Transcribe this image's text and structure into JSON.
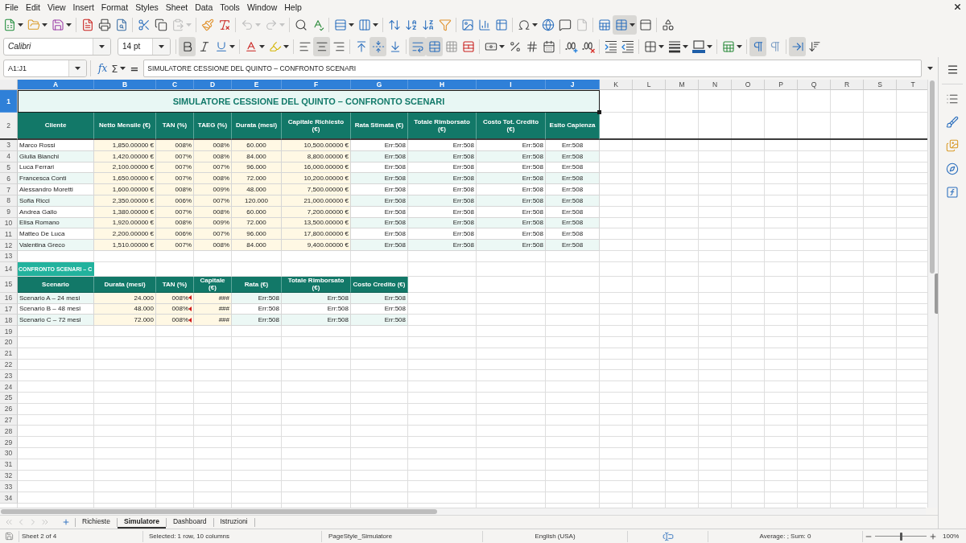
{
  "menu_bar": {
    "items": [
      "File",
      "Edit",
      "View",
      "Insert",
      "Format",
      "Styles",
      "Sheet",
      "Data",
      "Tools",
      "Window",
      "Help"
    ]
  },
  "standard_toolbar": {
    "groups": [
      [
        {
          "kind": "new",
          "dropdown": true,
          "pressed": false,
          "disabled": false
        },
        {
          "kind": "open",
          "dropdown": true,
          "pressed": false,
          "disabled": false
        },
        {
          "kind": "save",
          "dropdown": true,
          "pressed": false,
          "disabled": false
        }
      ],
      [
        {
          "kind": "export_pdf",
          "dropdown": false,
          "pressed": false,
          "disabled": false
        },
        {
          "kind": "print",
          "dropdown": false,
          "pressed": false,
          "disabled": false
        },
        {
          "kind": "print_preview",
          "dropdown": false,
          "pressed": false,
          "disabled": false
        }
      ],
      [
        {
          "kind": "cut",
          "dropdown": false,
          "pressed": false,
          "disabled": false
        },
        {
          "kind": "copy",
          "dropdown": false,
          "pressed": false,
          "disabled": false
        },
        {
          "kind": "paste",
          "dropdown": true,
          "pressed": false,
          "disabled": true
        }
      ],
      [
        {
          "kind": "clone_formatting",
          "dropdown": false,
          "pressed": false,
          "disabled": false
        },
        {
          "kind": "clear_formatting",
          "dropdown": false,
          "pressed": false,
          "disabled": false
        }
      ],
      [
        {
          "kind": "undo",
          "dropdown": true,
          "pressed": false,
          "disabled": true
        },
        {
          "kind": "redo",
          "dropdown": true,
          "pressed": false,
          "disabled": true
        }
      ],
      [
        {
          "kind": "find_replace",
          "dropdown": false,
          "pressed": false,
          "disabled": false
        },
        {
          "kind": "spelling",
          "dropdown": false,
          "pressed": false,
          "disabled": false
        }
      ],
      [
        {
          "kind": "rows",
          "dropdown": true,
          "pressed": false,
          "disabled": false
        },
        {
          "kind": "columns",
          "dropdown": true,
          "pressed": false,
          "disabled": false
        }
      ],
      [
        {
          "kind": "sort",
          "dropdown": false,
          "pressed": false,
          "disabled": false
        },
        {
          "kind": "sort_ascending",
          "dropdown": false,
          "pressed": false,
          "disabled": false
        },
        {
          "kind": "sort_descending",
          "dropdown": false,
          "pressed": false,
          "disabled": false
        },
        {
          "kind": "autofilter",
          "dropdown": false,
          "pressed": false,
          "disabled": false
        }
      ],
      [
        {
          "kind": "image",
          "dropdown": false,
          "pressed": false,
          "disabled": false
        },
        {
          "kind": "chart",
          "dropdown": false,
          "pressed": false,
          "disabled": false
        },
        {
          "kind": "pivot_table",
          "dropdown": false,
          "pressed": false,
          "disabled": false
        }
      ],
      [
        {
          "kind": "special_character",
          "dropdown": true,
          "pressed": false,
          "disabled": false
        },
        {
          "kind": "hyperlink",
          "dropdown": false,
          "pressed": false,
          "disabled": false
        },
        {
          "kind": "comment",
          "dropdown": false,
          "pressed": false,
          "disabled": false
        },
        {
          "kind": "header_footer",
          "dropdown": false,
          "pressed": false,
          "disabled": true
        }
      ],
      [
        {
          "kind": "print_area",
          "dropdown": false,
          "pressed": false,
          "disabled": false
        },
        {
          "kind": "freeze",
          "dropdown": true,
          "pressed": true,
          "disabled": false
        },
        {
          "kind": "split_window",
          "dropdown": false,
          "pressed": false,
          "disabled": false
        }
      ],
      [
        {
          "kind": "shapes",
          "dropdown": false,
          "pressed": false,
          "disabled": false
        }
      ]
    ]
  },
  "formatting_toolbar": {
    "font_name": "Calibri",
    "font_size": "14 pt",
    "groups": [
      [
        {
          "kind": "bold",
          "dropdown": false,
          "pressed": true,
          "disabled": false
        },
        {
          "kind": "italic",
          "dropdown": false,
          "pressed": false,
          "disabled": false
        },
        {
          "kind": "underline",
          "dropdown": true,
          "pressed": false,
          "disabled": false
        }
      ],
      [
        {
          "kind": "font_color",
          "dropdown": true,
          "pressed": false,
          "disabled": false
        },
        {
          "kind": "highlight",
          "dropdown": true,
          "pressed": false,
          "disabled": false
        }
      ],
      [
        {
          "kind": "align_left",
          "dropdown": false,
          "pressed": false,
          "disabled": false
        },
        {
          "kind": "align_center",
          "dropdown": false,
          "pressed": true,
          "disabled": false
        },
        {
          "kind": "align_right",
          "dropdown": false,
          "pressed": false,
          "disabled": false
        }
      ],
      [
        {
          "kind": "align_top",
          "dropdown": false,
          "pressed": false,
          "disabled": false
        },
        {
          "kind": "align_middle",
          "dropdown": false,
          "pressed": true,
          "disabled": false
        },
        {
          "kind": "align_bottom",
          "dropdown": false,
          "pressed": false,
          "disabled": false
        }
      ],
      [
        {
          "kind": "wrap_text",
          "dropdown": false,
          "pressed": true,
          "disabled": false
        },
        {
          "kind": "merge_center",
          "dropdown": false,
          "pressed": true,
          "disabled": false
        },
        {
          "kind": "merge_cells",
          "dropdown": false,
          "pressed": false,
          "disabled": false
        },
        {
          "kind": "unmerge_cells",
          "dropdown": false,
          "pressed": false,
          "disabled": false
        }
      ],
      [
        {
          "kind": "currency",
          "dropdown": true,
          "pressed": false,
          "disabled": false
        },
        {
          "kind": "percent",
          "dropdown": false,
          "pressed": false,
          "disabled": false
        },
        {
          "kind": "number",
          "dropdown": false,
          "pressed": false,
          "disabled": false
        },
        {
          "kind": "date",
          "dropdown": false,
          "pressed": false,
          "disabled": false
        }
      ],
      [
        {
          "kind": "add_decimal",
          "dropdown": false,
          "pressed": false,
          "disabled": false
        },
        {
          "kind": "delete_decimal",
          "dropdown": false,
          "pressed": false,
          "disabled": false
        }
      ],
      [
        {
          "kind": "indent_increase",
          "dropdown": false,
          "pressed": false,
          "disabled": false
        },
        {
          "kind": "indent_decrease",
          "dropdown": false,
          "pressed": false,
          "disabled": false
        }
      ],
      [
        {
          "kind": "borders",
          "dropdown": true,
          "pressed": false,
          "disabled": false
        },
        {
          "kind": "border_style",
          "dropdown": true,
          "pressed": false,
          "disabled": false
        },
        {
          "kind": "border_color",
          "dropdown": true,
          "pressed": false,
          "disabled": false
        }
      ],
      [
        {
          "kind": "conditional_format",
          "dropdown": true,
          "pressed": false,
          "disabled": false
        }
      ],
      [
        {
          "kind": "left_to_right",
          "dropdown": false,
          "pressed": true,
          "disabled": false
        },
        {
          "kind": "right_to_left",
          "dropdown": false,
          "pressed": false,
          "disabled": false
        }
      ],
      [
        {
          "kind": "text_horizontal",
          "dropdown": false,
          "pressed": true,
          "disabled": false
        },
        {
          "kind": "text_vertical",
          "dropdown": false,
          "pressed": false,
          "disabled": false
        }
      ]
    ]
  },
  "formula_bar": {
    "name_box": "A1:J1",
    "function_wizard": "fx",
    "sum": "Σ",
    "formula": "=",
    "content": "SIMULATORE CESSIONE DEL QUINTO – CONFRONTO SCENARI"
  },
  "sheet": {
    "column_headers": [
      {
        "label": "A",
        "selected": true
      },
      {
        "label": "B",
        "selected": true
      },
      {
        "label": "C",
        "selected": true
      },
      {
        "label": "D",
        "selected": true
      },
      {
        "label": "E",
        "selected": true
      },
      {
        "label": "F",
        "selected": true
      },
      {
        "label": "G",
        "selected": true
      },
      {
        "label": "H",
        "selected": true
      },
      {
        "label": "I",
        "selected": true
      },
      {
        "label": "J",
        "selected": true
      },
      {
        "label": "K",
        "selected": false
      },
      {
        "label": "L",
        "selected": false
      },
      {
        "label": "M",
        "selected": false
      },
      {
        "label": "N",
        "selected": false
      },
      {
        "label": "O",
        "selected": false
      },
      {
        "label": "P",
        "selected": false
      },
      {
        "label": "Q",
        "selected": false
      },
      {
        "label": "R",
        "selected": false
      },
      {
        "label": "S",
        "selected": false
      },
      {
        "label": "T",
        "selected": false
      }
    ],
    "row_headers": [
      {
        "label": "1",
        "selected": true
      },
      {
        "label": "2",
        "selected": false
      },
      {
        "label": "3",
        "selected": false
      },
      {
        "label": "4",
        "selected": false
      },
      {
        "label": "5",
        "selected": false
      },
      {
        "label": "6",
        "selected": false
      },
      {
        "label": "7",
        "selected": false
      },
      {
        "label": "8",
        "selected": false
      },
      {
        "label": "9",
        "selected": false
      },
      {
        "label": "10",
        "selected": false
      },
      {
        "label": "11",
        "selected": false
      },
      {
        "label": "12",
        "selected": false
      },
      {
        "label": "13",
        "selected": false
      },
      {
        "label": "14",
        "selected": false
      },
      {
        "label": "15",
        "selected": false
      },
      {
        "label": "16",
        "selected": false
      },
      {
        "label": "17",
        "selected": false
      },
      {
        "label": "18",
        "selected": false
      },
      {
        "label": "19",
        "selected": false
      },
      {
        "label": "20",
        "selected": false
      },
      {
        "label": "21",
        "selected": false
      },
      {
        "label": "22",
        "selected": false
      },
      {
        "label": "23",
        "selected": false
      },
      {
        "label": "24",
        "selected": false
      },
      {
        "label": "25",
        "selected": false
      },
      {
        "label": "26",
        "selected": false
      },
      {
        "label": "27",
        "selected": false
      },
      {
        "label": "28",
        "selected": false
      },
      {
        "label": "29",
        "selected": false
      },
      {
        "label": "30",
        "selected": false
      },
      {
        "label": "31",
        "selected": false
      },
      {
        "label": "32",
        "selected": false
      },
      {
        "label": "33",
        "selected": false
      },
      {
        "label": "34",
        "selected": false
      }
    ],
    "title": "SIMULATORE CESSIONE DEL QUINTO – CONFRONTO SCENARI",
    "client_table": {
      "columns": [
        {
          "label": "Cliente",
          "kind": "name"
        },
        {
          "label": "Netto Mensile (€)",
          "kind": "input"
        },
        {
          "label": "TAN (%)",
          "kind": "input"
        },
        {
          "label": "TAEG (%)",
          "kind": "input"
        },
        {
          "label": "Durata (mesi)",
          "kind": "period"
        },
        {
          "label": "Capitale Richiesto (€)",
          "kind": "input"
        },
        {
          "label": "Rata Stimata (€)",
          "kind": "result"
        },
        {
          "label": "Totale Rimborsato (€)",
          "kind": "result"
        },
        {
          "label": "Costo Tot. Credito (€)",
          "kind": "result"
        },
        {
          "label": "Esito Capienza",
          "kind": "verdict"
        }
      ],
      "rows": [
        [
          "Marco Rossi",
          "1,850.00000 €",
          "008%",
          "008%",
          "60.000",
          "10,500.00000 €",
          "Err:508",
          "Err:508",
          "Err:508",
          "Err:508"
        ],
        [
          "Giulia Bianchi",
          "1,420.00000 €",
          "007%",
          "008%",
          "84.000",
          "8,800.00000 €",
          "Err:508",
          "Err:508",
          "Err:508",
          "Err:508"
        ],
        [
          "Luca Ferrari",
          "2,100.00000 €",
          "007%",
          "007%",
          "96.000",
          "16,000.00000 €",
          "Err:508",
          "Err:508",
          "Err:508",
          "Err:508"
        ],
        [
          "Francesca Conti",
          "1,650.00000 €",
          "007%",
          "008%",
          "72.000",
          "10,200.00000 €",
          "Err:508",
          "Err:508",
          "Err:508",
          "Err:508"
        ],
        [
          "Alessandro Moretti",
          "1,600.00000 €",
          "008%",
          "009%",
          "48.000",
          "7,500.00000 €",
          "Err:508",
          "Err:508",
          "Err:508",
          "Err:508"
        ],
        [
          "Sofia Ricci",
          "2,350.00000 €",
          "006%",
          "007%",
          "120.000",
          "21,000.00000 €",
          "Err:508",
          "Err:508",
          "Err:508",
          "Err:508"
        ],
        [
          "Andrea Gallo",
          "1,380.00000 €",
          "007%",
          "008%",
          "60.000",
          "7,200.00000 €",
          "Err:508",
          "Err:508",
          "Err:508",
          "Err:508"
        ],
        [
          "Elisa Romano",
          "1,920.00000 €",
          "008%",
          "009%",
          "72.000",
          "13,500.00000 €",
          "Err:508",
          "Err:508",
          "Err:508",
          "Err:508"
        ],
        [
          "Matteo De Luca",
          "2,200.00000 €",
          "006%",
          "007%",
          "96.000",
          "17,800.00000 €",
          "Err:508",
          "Err:508",
          "Err:508",
          "Err:508"
        ],
        [
          "Valentina Greco",
          "1,510.00000 €",
          "007%",
          "008%",
          "84.000",
          "9,400.00000 €",
          "Err:508",
          "Err:508",
          "Err:508",
          "Err:508"
        ]
      ]
    },
    "scenario_section": {
      "title": "CONFRONTO SCENARI – C",
      "columns": [
        {
          "label": "Scenario",
          "kind": "name",
          "overflow": false
        },
        {
          "label": "Durata (mesi)",
          "kind": "input",
          "overflow": false
        },
        {
          "label": "TAN (%)",
          "kind": "input",
          "overflow": true
        },
        {
          "label": "Capitale (€)",
          "kind": "input",
          "overflow": false
        },
        {
          "label": "Rata (€)",
          "kind": "result",
          "overflow": false
        },
        {
          "label": "Totale Rimborsato (€)",
          "kind": "result",
          "overflow": false
        },
        {
          "label": "Costo Credito (€)",
          "kind": "result",
          "overflow": false
        }
      ],
      "rows": [
        [
          "Scenario A – 24 mesi",
          "24.000",
          "008%",
          "###",
          "Err:508",
          "Err:508",
          "Err:508"
        ],
        [
          "Scenario B – 48 mesi",
          "48.000",
          "008%",
          "###",
          "Err:508",
          "Err:508",
          "Err:508"
        ],
        [
          "Scenario C – 72 mesi",
          "72.000",
          "008%",
          "###",
          "Err:508",
          "Err:508",
          "Err:508"
        ]
      ]
    }
  },
  "sheet_tabs": {
    "tabs": [
      {
        "label": "Richieste",
        "selected": false
      },
      {
        "label": "Simulatore",
        "selected": true
      },
      {
        "label": "Dashboard",
        "selected": false
      },
      {
        "label": "Istruzioni",
        "selected": false
      }
    ]
  },
  "status_bar": {
    "sheet": "Sheet 2 of 4",
    "selection": "Selected: 1 row, 10 columns",
    "page_style": "PageStyle_Simulatore",
    "language": "English (USA)",
    "summary": "Average: ; Sum: 0",
    "zoom": {
      "level": 0.5,
      "reading": "100%"
    }
  }
}
